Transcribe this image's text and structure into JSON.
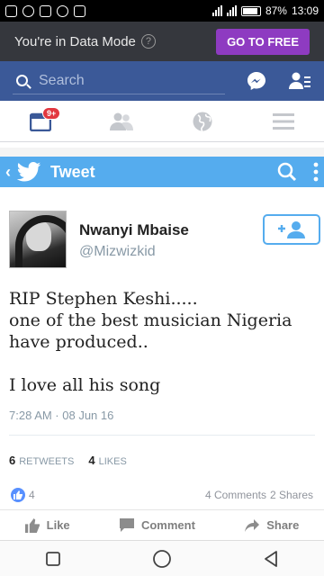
{
  "status_bar": {
    "battery": "87%",
    "time": "13:09"
  },
  "data_banner": {
    "text": "You're in Data Mode",
    "help_glyph": "?",
    "button_label": "GO TO FREE",
    "button_color": "#8e3bc1"
  },
  "header": {
    "search_placeholder": "Search",
    "brand_color": "#3b5998"
  },
  "tabs": {
    "notification_badge": "9+"
  },
  "twitter": {
    "bar_title": "Tweet",
    "bar_color": "#55acee",
    "author_name": "Nwanyi Mbaise",
    "author_handle": "@Mizwizkid",
    "text": "RIP Stephen Keshi.....\none of the best musician Nigeria have produced..\n\nI love all his song",
    "timestamp": "7:28 AM · 08 Jun 16",
    "retweets_count": "6",
    "retweets_label": "RETWEETS",
    "likes_count": "4",
    "likes_label": "LIKES"
  },
  "post": {
    "like_count": "4",
    "comments": "4 Comments",
    "shares": "2 Shares",
    "like_label": "Like",
    "comment_label": "Comment",
    "share_label": "Share"
  }
}
